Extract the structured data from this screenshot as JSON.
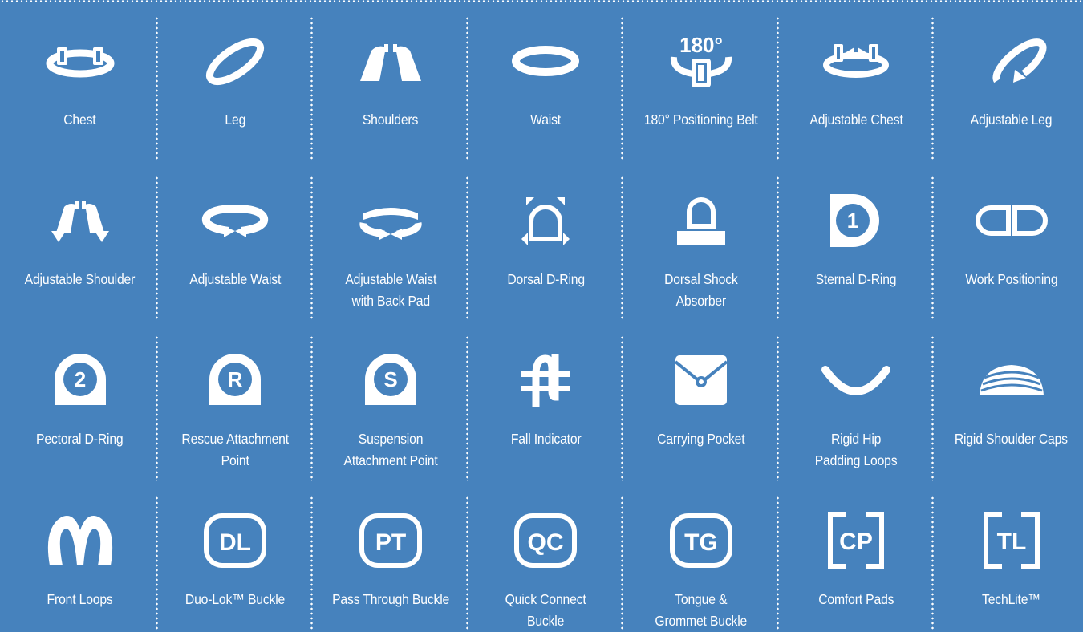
{
  "page": {
    "background": "#4682bd",
    "foreground": "#ffffff"
  },
  "features": [
    {
      "icon": "chest-strap-icon",
      "label": "Chest"
    },
    {
      "icon": "leg-strap-icon",
      "label": "Leg"
    },
    {
      "icon": "shoulder-straps-icon",
      "label": "Shoulders"
    },
    {
      "icon": "waist-belt-icon",
      "label": "Waist"
    },
    {
      "icon": "positioning-belt-180-icon",
      "label": "180° Positioning Belt",
      "icon_text": "180°"
    },
    {
      "icon": "adjustable-chest-icon",
      "label": "Adjustable Chest"
    },
    {
      "icon": "adjustable-leg-icon",
      "label": "Adjustable Leg"
    },
    {
      "icon": "adjustable-shoulder-icon",
      "label": "Adjustable Shoulder"
    },
    {
      "icon": "adjustable-waist-icon",
      "label": "Adjustable Waist"
    },
    {
      "icon": "adjustable-waist-back-pad-icon",
      "label": "Adjustable Waist\nwith Back Pad"
    },
    {
      "icon": "dorsal-d-ring-icon",
      "label": "Dorsal D-Ring"
    },
    {
      "icon": "dorsal-shock-absorber-icon",
      "label": "Dorsal Shock\nAbsorber"
    },
    {
      "icon": "sternal-d-ring-icon",
      "label": "Sternal D-Ring",
      "icon_text": "1"
    },
    {
      "icon": "work-positioning-icon",
      "label": "Work Positioning"
    },
    {
      "icon": "pectoral-d-ring-icon",
      "label": "Pectoral D-Ring",
      "icon_text": "2"
    },
    {
      "icon": "rescue-attachment-icon",
      "label": "Rescue Attachment\nPoint",
      "icon_text": "R"
    },
    {
      "icon": "suspension-attachment-icon",
      "label": "Suspension\nAttachment Point",
      "icon_text": "S"
    },
    {
      "icon": "fall-indicator-icon",
      "label": "Fall Indicator"
    },
    {
      "icon": "carrying-pocket-icon",
      "label": "Carrying Pocket"
    },
    {
      "icon": "rigid-hip-padding-loops-icon",
      "label": "Rigid Hip\nPadding Loops"
    },
    {
      "icon": "rigid-shoulder-caps-icon",
      "label": "Rigid Shoulder Caps"
    },
    {
      "icon": "front-loops-icon",
      "label": "Front Loops"
    },
    {
      "icon": "duo-lok-buckle-icon",
      "label": "Duo-Lok™ Buckle",
      "icon_text": "DL"
    },
    {
      "icon": "pass-through-buckle-icon",
      "label": "Pass Through Buckle",
      "icon_text": "PT"
    },
    {
      "icon": "quick-connect-buckle-icon",
      "label": "Quick Connect\nBuckle",
      "icon_text": "QC"
    },
    {
      "icon": "tongue-grommet-buckle-icon",
      "label": "Tongue &\nGrommet Buckle",
      "icon_text": "TG"
    },
    {
      "icon": "comfort-pads-icon",
      "label": "Comfort Pads",
      "icon_text": "CP"
    },
    {
      "icon": "techlite-icon",
      "label": "TechLite™",
      "icon_text": "TL"
    }
  ]
}
